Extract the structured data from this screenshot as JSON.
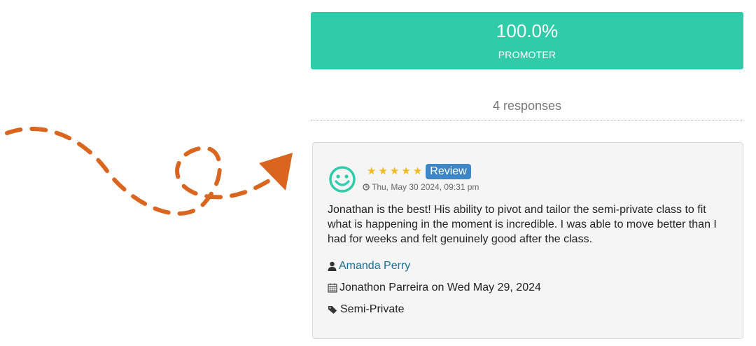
{
  "summary": {
    "percentage": "100.0%",
    "category": "PROMOTER",
    "responses": "4 responses"
  },
  "review": {
    "stars": [
      "★",
      "★",
      "★",
      "★",
      "★"
    ],
    "rating": 5,
    "badge": "Review",
    "timestamp": "Thu, May 30 2024, 09:31 pm",
    "text": "Jonathan is the best! His ability to pivot and tailor the semi-private class to fit what is happening in the moment is incredible. I was able to move better than I had for weeks and felt genuinely good after the class.",
    "author": "Amanda Perry",
    "session": "Jonathon Parreira on Wed May 29, 2024",
    "tag": "Semi-Private"
  },
  "colors": {
    "banner": "#30ccaa",
    "badge": "#3d87c8",
    "star": "#f3b81d",
    "smiley": "#30ccaa",
    "arrow": "#d9651f",
    "author_link": "#1a6f94"
  },
  "icons": [
    "smiley-icon",
    "star-icon",
    "clock-icon",
    "user-icon",
    "calendar-icon",
    "tag-icon",
    "curved-arrow-icon"
  ]
}
